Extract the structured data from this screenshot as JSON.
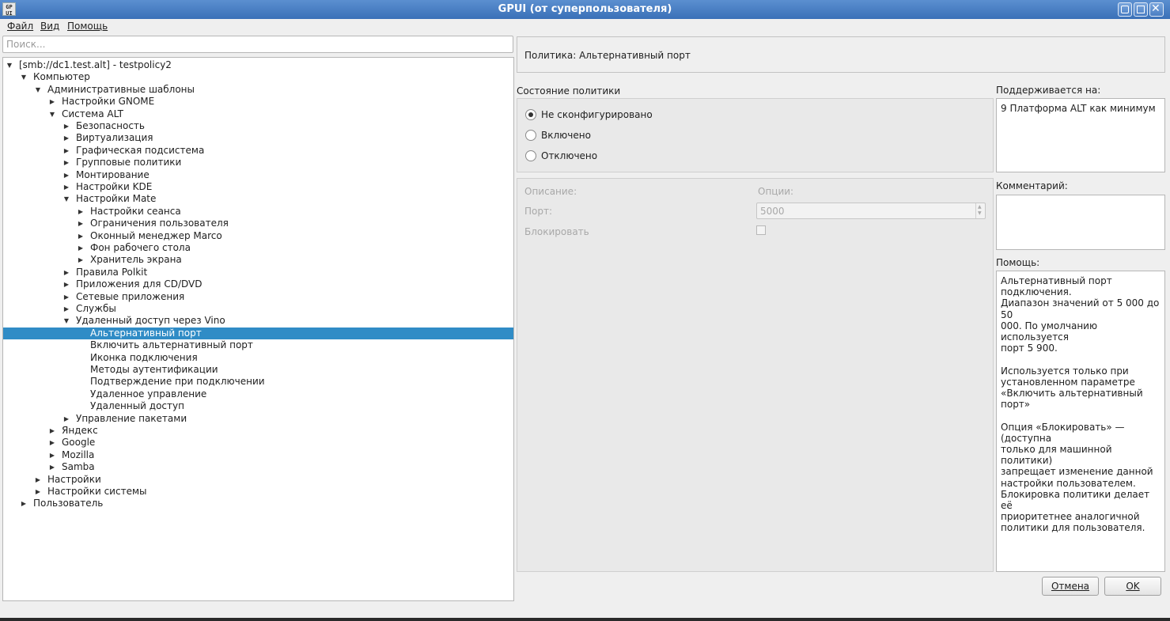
{
  "window": {
    "title": "GPUI (от суперпользователя)",
    "icon_text": "GP\nUI"
  },
  "menu": [
    "Файл",
    "Вид",
    "Помощь"
  ],
  "search": {
    "placeholder": "Поиск..."
  },
  "tree": [
    {
      "label": "[smb://dc1.test.alt] - testpolicy2",
      "depth": 0,
      "arrow": "expanded"
    },
    {
      "label": "Компьютер",
      "depth": 1,
      "arrow": "expanded"
    },
    {
      "label": "Административные шаблоны",
      "depth": 2,
      "arrow": "expanded"
    },
    {
      "label": "Настройки GNOME",
      "depth": 3,
      "arrow": "collapsed"
    },
    {
      "label": "Система ALT",
      "depth": 3,
      "arrow": "expanded"
    },
    {
      "label": "Безопасность",
      "depth": 4,
      "arrow": "collapsed"
    },
    {
      "label": "Виртуализация",
      "depth": 4,
      "arrow": "collapsed"
    },
    {
      "label": "Графическая подсистема",
      "depth": 4,
      "arrow": "collapsed"
    },
    {
      "label": "Групповые политики",
      "depth": 4,
      "arrow": "collapsed"
    },
    {
      "label": "Монтирование",
      "depth": 4,
      "arrow": "collapsed"
    },
    {
      "label": "Настройки KDE",
      "depth": 4,
      "arrow": "collapsed"
    },
    {
      "label": "Настройки Mate",
      "depth": 4,
      "arrow": "expanded"
    },
    {
      "label": "Настройки сеанса",
      "depth": 5,
      "arrow": "collapsed"
    },
    {
      "label": "Ограничения пользователя",
      "depth": 5,
      "arrow": "collapsed"
    },
    {
      "label": "Оконный менеджер Marco",
      "depth": 5,
      "arrow": "collapsed"
    },
    {
      "label": "Фон рабочего стола",
      "depth": 5,
      "arrow": "collapsed"
    },
    {
      "label": "Хранитель экрана",
      "depth": 5,
      "arrow": "collapsed"
    },
    {
      "label": "Правила Polkit",
      "depth": 4,
      "arrow": "collapsed"
    },
    {
      "label": "Приложения для CD/DVD",
      "depth": 4,
      "arrow": "collapsed"
    },
    {
      "label": "Сетевые приложения",
      "depth": 4,
      "arrow": "collapsed"
    },
    {
      "label": "Службы",
      "depth": 4,
      "arrow": "collapsed"
    },
    {
      "label": "Удаленный доступ через Vino",
      "depth": 4,
      "arrow": "expanded"
    },
    {
      "label": "Альтернативный порт",
      "depth": 5,
      "arrow": "none",
      "selected": true
    },
    {
      "label": "Включить альтернативный порт",
      "depth": 5,
      "arrow": "none"
    },
    {
      "label": "Иконка подключения",
      "depth": 5,
      "arrow": "none"
    },
    {
      "label": "Методы аутентификации",
      "depth": 5,
      "arrow": "none"
    },
    {
      "label": "Подтверждение при подключении",
      "depth": 5,
      "arrow": "none"
    },
    {
      "label": "Удаленное управление",
      "depth": 5,
      "arrow": "none"
    },
    {
      "label": "Удаленный доступ",
      "depth": 5,
      "arrow": "none"
    },
    {
      "label": "Управление пакетами",
      "depth": 4,
      "arrow": "collapsed"
    },
    {
      "label": "Яндекс",
      "depth": 3,
      "arrow": "collapsed"
    },
    {
      "label": "Google",
      "depth": 3,
      "arrow": "collapsed"
    },
    {
      "label": "Mozilla",
      "depth": 3,
      "arrow": "collapsed"
    },
    {
      "label": "Samba",
      "depth": 3,
      "arrow": "collapsed"
    },
    {
      "label": "Настройки",
      "depth": 2,
      "arrow": "collapsed"
    },
    {
      "label": "Настройки системы",
      "depth": 2,
      "arrow": "collapsed"
    },
    {
      "label": "Пользователь",
      "depth": 1,
      "arrow": "collapsed"
    }
  ],
  "policy": {
    "header": "Политика: Альтернативный порт",
    "state_label": "Состояние политики",
    "states": [
      "Не сконфигурировано",
      "Включено",
      "Отключено"
    ],
    "selected_state": 0,
    "description_label": "Описание:",
    "options_label": "Опции:",
    "port_label": "Порт:",
    "port_value": "5000",
    "lock_label": "Блокировать",
    "supported_label": "Поддерживается на:",
    "supported_value": "9 Платформа ALT как минимум",
    "comment_label": "Комментарий:",
    "comment_value": "",
    "help_label": "Помощь:",
    "help_text": "Альтернативный порт подключения.\nДиапазон значений от 5 000 до 50\n000. По умолчанию используется\nпорт 5 900.\n\nИспользуется только при\nустановленном параметре\n«Включить альтернативный порт»\n\nОпция «Блокировать» — (доступна\nтолько для машинной политики)\nзапрещает изменение данной\nнастройки пользователем.\nБлокировка политики делает её\nприоритетнее аналогичной\nполитики для пользователя."
  },
  "buttons": {
    "cancel": "Отмена",
    "ok": "OK"
  },
  "colors": {
    "titlebar": "#3a70b8",
    "selection": "#308cc6"
  }
}
